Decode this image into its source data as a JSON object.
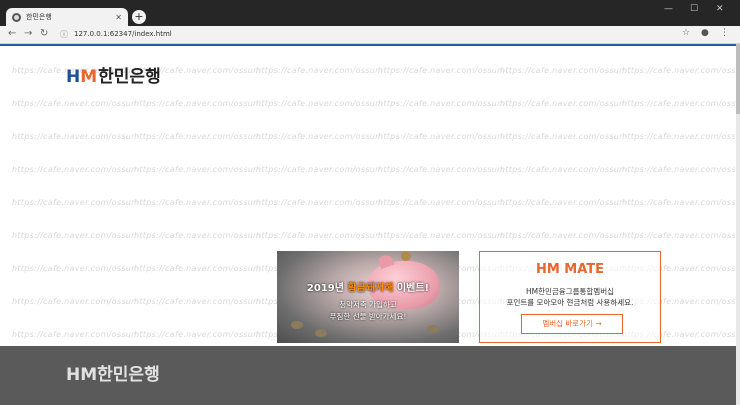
{
  "browser": {
    "tab_title": "한민은행",
    "tab_close": "✕",
    "new_tab": "+",
    "window_controls": [
      "—",
      "☐",
      "✕"
    ],
    "nav": {
      "back": "←",
      "forward": "→",
      "reload": "↻"
    },
    "url": "127.0.0.1:62347/index.html",
    "info_icon": "ⓘ",
    "star_icon": "☆",
    "account_icon": "●",
    "menu_icon": "⋮"
  },
  "watermark_text": "https://cafe.naver.com/ossum",
  "header": {
    "logo_h": "H",
    "logo_m": "M",
    "logo_korean": "한민은행"
  },
  "banner": {
    "headline_year": "2019년",
    "headline_gold": "황금돼지해",
    "headline_end": "이벤트!",
    "sub_line1": "청약저축 가입하고",
    "sub_line2": "푸짐한 선물 받아가세요!"
  },
  "mate": {
    "title": "HM MATE",
    "desc_line1": "HM한민금융그룹통합멤버십",
    "desc_line2": "포인트를 모아모아 현금처럼 사용하세요.",
    "button_label": "멤버십 바로가기 →"
  },
  "footer": {
    "logo": "HM한민은행"
  },
  "colors": {
    "brand_blue": "#1b4f9c",
    "brand_orange": "#e8672c",
    "footer_bg": "#5a5a5a"
  }
}
